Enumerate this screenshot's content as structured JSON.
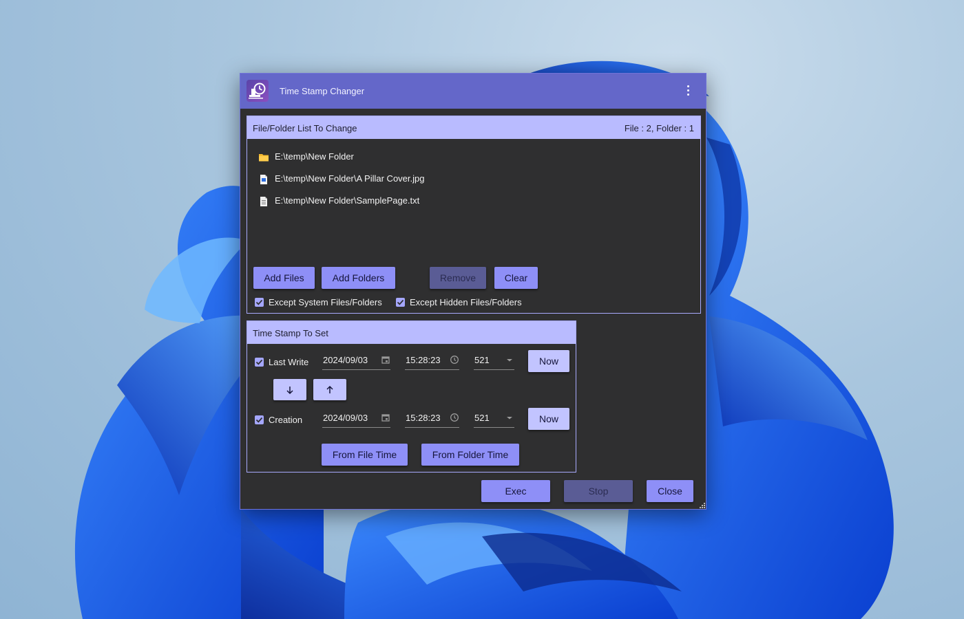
{
  "window": {
    "title": "Time Stamp Changer",
    "accent_color": "#6467c9",
    "button_color": "#8e8ff7",
    "header_color": "#b9bbff"
  },
  "file_panel": {
    "title": "File/Folder List To Change",
    "count_text": "File : 2, Folder : 1",
    "items": [
      {
        "icon": "folder-icon",
        "path": "E:\\temp\\New Folder"
      },
      {
        "icon": "image-file-icon",
        "path": "E:\\temp\\New Folder\\A Pillar Cover.jpg"
      },
      {
        "icon": "text-file-icon",
        "path": "E:\\temp\\New Folder\\SamplePage.txt"
      }
    ],
    "buttons": {
      "add_files": "Add Files",
      "add_folders": "Add Folders",
      "remove": "Remove",
      "clear": "Clear"
    },
    "options": {
      "except_system": {
        "label": "Except System Files/Folders",
        "checked": true
      },
      "except_hidden": {
        "label": "Except Hidden Files/Folders",
        "checked": true
      }
    }
  },
  "timestamp_panel": {
    "title": "Time Stamp To Set",
    "last_write": {
      "label": "Last Write",
      "checked": true,
      "date": "2024/09/03",
      "time": "15:28:23",
      "ms": "521",
      "now_label": "Now"
    },
    "creation": {
      "label": "Creation",
      "checked": true,
      "date": "2024/09/03",
      "time": "15:28:23",
      "ms": "521",
      "now_label": "Now"
    },
    "buttons": {
      "from_file_time": "From File Time",
      "from_folder_time": "From Folder Time"
    }
  },
  "footer": {
    "exec": "Exec",
    "stop": "Stop",
    "close": "Close"
  }
}
